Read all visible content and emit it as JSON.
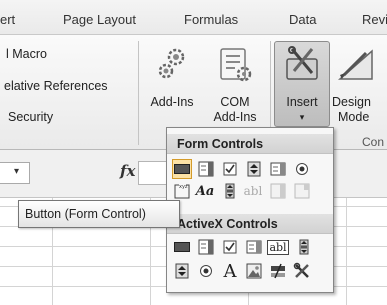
{
  "ribbon": {
    "tabs": [
      "ert",
      "Page Layout",
      "Formulas",
      "Data",
      "Revi"
    ],
    "code_group": {
      "macro_label": "l Macro",
      "relative_refs_label": "elative References",
      "security_label": "Security"
    },
    "addins_group": {
      "addins_label": "Add-Ins",
      "com_label_1": "COM",
      "com_label_2": "Add-Ins"
    },
    "controls_group": {
      "insert_label": "Insert",
      "insert_arrow": "▾",
      "design_label_1": "Design",
      "design_label_2": "Mode",
      "group_caption": "Con"
    }
  },
  "formula_bar": {
    "fx_label": "fx"
  },
  "tooltip": {
    "text": "Button (Form Control)"
  },
  "insert_gallery": {
    "form_controls_title": "Form Controls",
    "activex_controls_title": "ActiveX Controls",
    "form_controls": [
      "button-form-control-icon",
      "combo-box-icon",
      "check-box-icon",
      "spin-button-icon",
      "list-box-icon",
      "option-button-icon",
      "group-box-icon",
      "label-icon",
      "scroll-bar-icon",
      "text-field-icon",
      "combo-list-edit-icon",
      "combo-drop-down-edit-icon"
    ],
    "activex_controls": [
      "command-button-icon",
      "activex-combo-box-icon",
      "activex-check-box-icon",
      "activex-list-box-icon",
      "activex-text-box-icon",
      "activex-scroll-bar-icon",
      "activex-spin-button-icon",
      "activex-option-button-icon",
      "activex-label-icon",
      "activex-image-icon",
      "toggle-button-icon",
      "more-controls-icon"
    ],
    "label_glyph": "Aa",
    "text_field_glyph": "abl",
    "activex_text_glyph": "abl",
    "activex_label_glyph": "A",
    "hovered_item": "button-form-control-icon",
    "hover_color": "#fce2a6"
  }
}
